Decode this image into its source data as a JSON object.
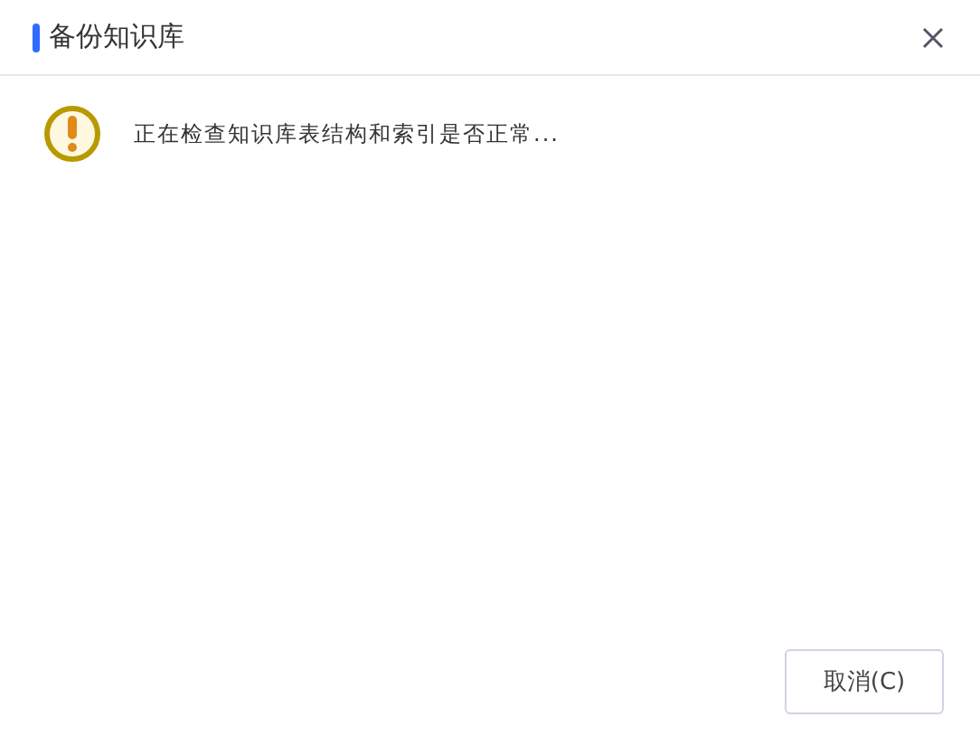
{
  "window": {
    "title": "备份知识库"
  },
  "message": {
    "text": "正在检查知识库表结构和索引是否正常..."
  },
  "buttons": [
    {
      "label": "取消(C)"
    }
  ]
}
